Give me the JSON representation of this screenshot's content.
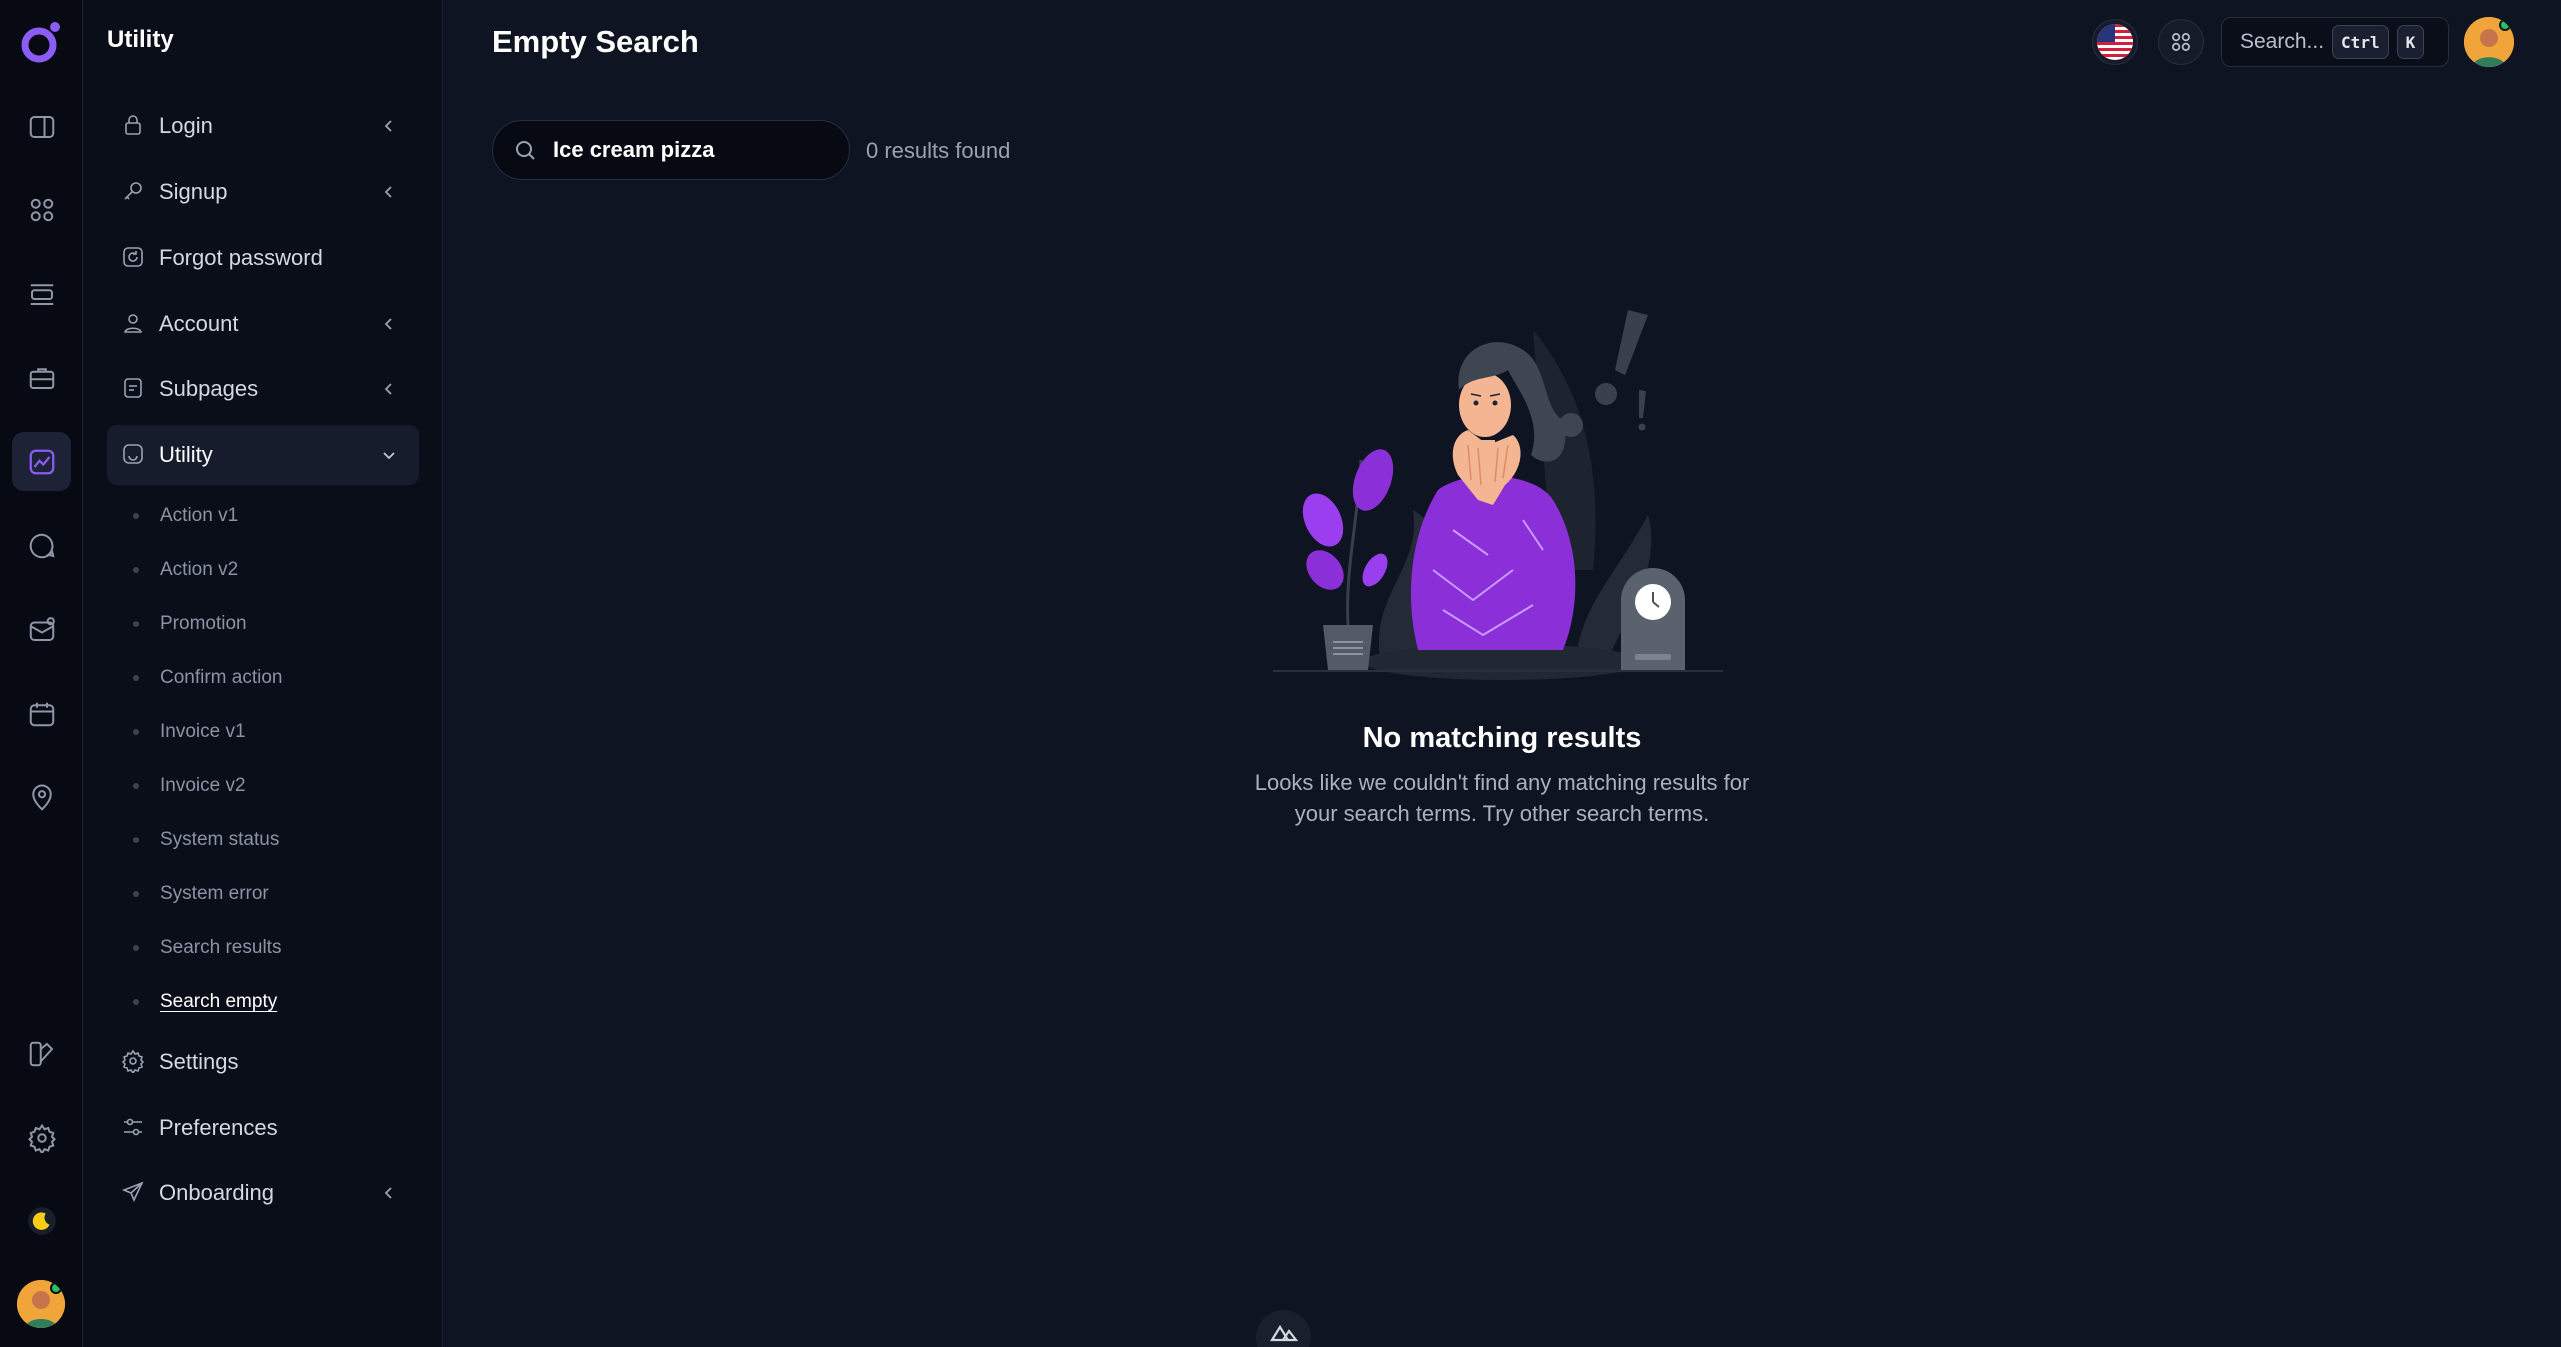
{
  "sidebar": {
    "title": "Utility",
    "items": [
      {
        "label": "Login"
      },
      {
        "label": "Signup"
      },
      {
        "label": "Forgot password"
      },
      {
        "label": "Account"
      },
      {
        "label": "Subpages"
      },
      {
        "label": "Utility"
      },
      {
        "label": "Settings"
      },
      {
        "label": "Preferences"
      },
      {
        "label": "Onboarding"
      }
    ],
    "subitems": [
      {
        "label": "Action v1"
      },
      {
        "label": "Action v2"
      },
      {
        "label": "Promotion"
      },
      {
        "label": "Confirm action"
      },
      {
        "label": "Invoice v1"
      },
      {
        "label": "Invoice v2"
      },
      {
        "label": "System status"
      },
      {
        "label": "System error"
      },
      {
        "label": "Search results"
      },
      {
        "label": "Search empty"
      }
    ]
  },
  "header": {
    "title": "Empty Search",
    "search_label": "Search...",
    "kbd_ctrl": "Ctrl",
    "kbd_k": "K"
  },
  "search": {
    "value": "Ice cream pizza",
    "results": "0 results found"
  },
  "empty_state": {
    "title": "No matching results",
    "text": "Looks like we couldn't find any matching results for your search terms. Try other search terms."
  },
  "colors": {
    "accent": "#7c3aed",
    "purple": "#8b2fd9",
    "background": "#0f1422"
  }
}
